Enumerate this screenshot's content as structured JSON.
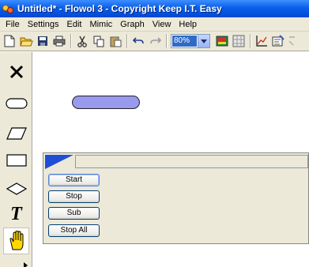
{
  "window": {
    "title": "Untitled* - Flowol 3 - Copyright Keep I.T. Easy"
  },
  "menu": {
    "items": [
      "File",
      "Settings",
      "Edit",
      "Mimic",
      "Graph",
      "View",
      "Help"
    ]
  },
  "toolbar": {
    "zoom": "80%",
    "icons": [
      "new-file-icon",
      "open-folder-icon",
      "save-disk-icon",
      "print-icon",
      "cut-icon",
      "copy-icon",
      "paste-icon",
      "undo-icon",
      "redo-icon",
      "zoom-select",
      "color-icon",
      "grid-icon",
      "graph-icon",
      "properties-icon"
    ]
  },
  "palette": {
    "tools": [
      "delete-tool",
      "oval-tool",
      "parallelogram-tool",
      "rectangle-tool",
      "diamond-tool",
      "text-tool",
      "hand-tool"
    ],
    "text_tool_glyph": "T"
  },
  "control_panel": {
    "buttons": [
      "Start",
      "Stop",
      "Sub",
      "Stop All"
    ]
  },
  "colors": {
    "title_bar": "#0a5fe8",
    "oval_fill": "#9999ee",
    "hand_fill": "#ffd800",
    "panel_corner": "#1f4fd6"
  }
}
